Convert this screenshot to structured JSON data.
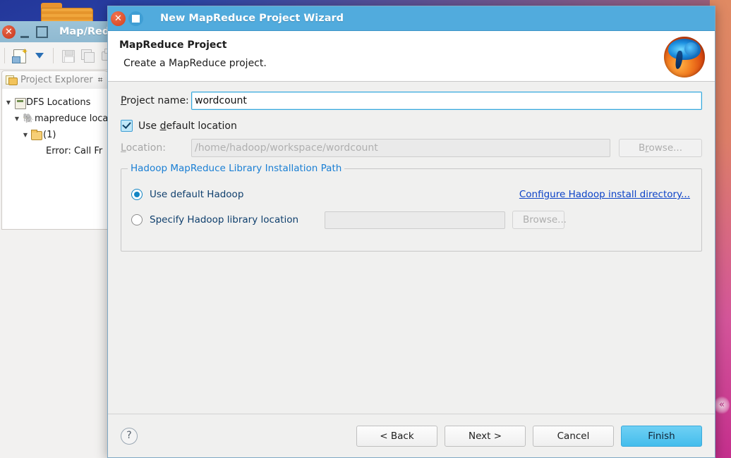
{
  "desktop": {
    "folder_icon": "folder-icon",
    "scroll_chevron": "«"
  },
  "eclipse_window": {
    "title": "Map/Redu",
    "close_glyph": "✕",
    "toolbar": [
      {
        "name": "new-file-icon"
      },
      {
        "name": "dropdown-caret-icon"
      },
      {
        "name": "save-icon"
      },
      {
        "name": "save-all-icon"
      },
      {
        "name": "print-icon"
      }
    ],
    "view": {
      "tab_label": "Project Explorer",
      "maximize_glyph": "⌗",
      "tree": [
        {
          "twisty": "▼",
          "icon": "dfs-locations-icon",
          "label": "DFS Locations",
          "indent": 0
        },
        {
          "twisty": "▼",
          "icon": "elephant-icon",
          "label": "mapreduce loca",
          "indent": 1
        },
        {
          "twisty": "▼",
          "icon": "folder-icon",
          "label": "(1)",
          "indent": 2
        },
        {
          "twisty": "",
          "icon": "",
          "label": "Error: Call Fr",
          "indent": 4
        }
      ]
    }
  },
  "dialog": {
    "window_title": "New MapReduce Project Wizard",
    "close_glyph": "✕",
    "header": {
      "title": "MapReduce Project",
      "subtitle": "Create a MapReduce project.",
      "logo_name": "hadoop-mapreduce-logo"
    },
    "project_name": {
      "label_pre": "",
      "label_mn": "P",
      "label_post": "roject name:",
      "value": "wordcount",
      "placeholder": ""
    },
    "use_default_location": {
      "label_pre": "Use ",
      "label_mn": "d",
      "label_post": "efault location",
      "checked": true
    },
    "location": {
      "label_pre": "",
      "label_mn": "L",
      "label_post": "ocation:",
      "value": "/home/hadoop/workspace/wordcount",
      "enabled": false,
      "browse_pre": "B",
      "browse_mn": "r",
      "browse_post": "owse...",
      "browse_enabled": false
    },
    "group": {
      "title": "Hadoop MapReduce Library Installation Path",
      "option_default": {
        "label": "Use default Hadoop",
        "selected": true
      },
      "option_specify": {
        "label": "Specify Hadoop library location",
        "selected": false,
        "value": "",
        "browse_label": "Browse...",
        "browse_enabled": false
      },
      "configure_link": "Configure Hadoop install directory..."
    },
    "footer": {
      "help_glyph": "?",
      "back_label": "< Back",
      "next_label": "Next >",
      "cancel_label": "Cancel",
      "finish_label": "Finish"
    },
    "colors": {
      "titlebar": "#51abdd",
      "accent": "#1a7fd4",
      "link": "#0b42c7",
      "primary_button": "#44bdec"
    }
  }
}
